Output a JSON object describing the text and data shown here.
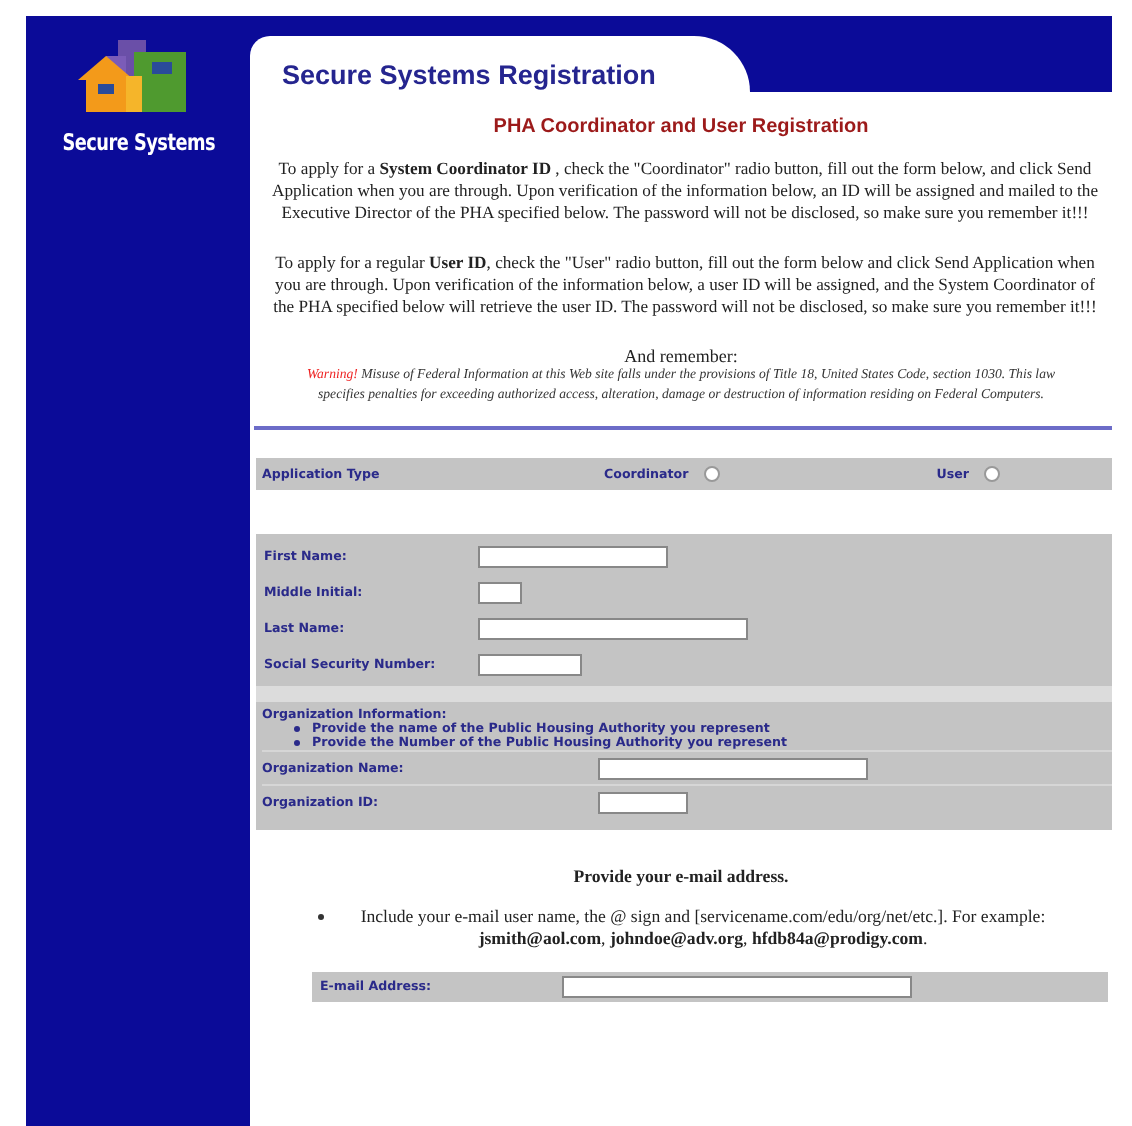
{
  "sidebar": {
    "logo_text": "Secure Systems"
  },
  "header": {
    "title": "Secure Systems Registration"
  },
  "subtitle": "PHA Coordinator and User Registration",
  "intro": [
    "To apply for a **System Coordinator ID** , check the \"Coordinator\" radio button, fill out the form below, and click Send Application when you are through. Upon verification of the information below, an ID will be assigned and mailed to the Executive Director of the PHA specified below. The password will not be disclosed, so make sure you remember it!!!",
    "To apply for a regular **User ID**, check the \"User\" radio button, fill out the form below and click Send Application when you are through. Upon verification of the information below, a user ID will be assigned, and the System Coordinator of the PHA specified below will retrieve the user ID. The password will not be disclosed, so make sure you remember it!!!"
  ],
  "reminder": {
    "heading": "And remember:",
    "warning_label": "Warning!",
    "warning_text": "Misuse of Federal Information at this Web site falls under the provisions of Title 18, United States Code, section 1030. This law specifies penalties for exceeding authorized access, alteration, damage or destruction of information residing on Federal Computers."
  },
  "application_type": {
    "label": "Application Type",
    "options": [
      {
        "label": "Coordinator",
        "selected": false
      },
      {
        "label": "User",
        "selected": false
      }
    ]
  },
  "personal_fields": [
    {
      "label": "First Name:"
    },
    {
      "label": "Middle Initial:"
    },
    {
      "label": "Last Name:"
    },
    {
      "label": "Social Security Number:"
    }
  ],
  "organization": {
    "heading": "Organization Information:",
    "bullets": [
      "Provide the name of the Public Housing Authority you represent",
      "Provide the Number of the Public Housing Authority you represent"
    ],
    "fields": [
      {
        "label": "Organization Name:"
      },
      {
        "label": "Organization ID:"
      }
    ]
  },
  "email": {
    "heading": "Provide your e-mail address.",
    "note": "Include your e-mail user name, the @ sign and [servicename.com/edu/org/net/etc.]. For example: **jsmith@aol.com**, **johndoe@adv.org**, **hfdb84a@prodigy.com**.",
    "field_label": "E-mail Address:"
  }
}
